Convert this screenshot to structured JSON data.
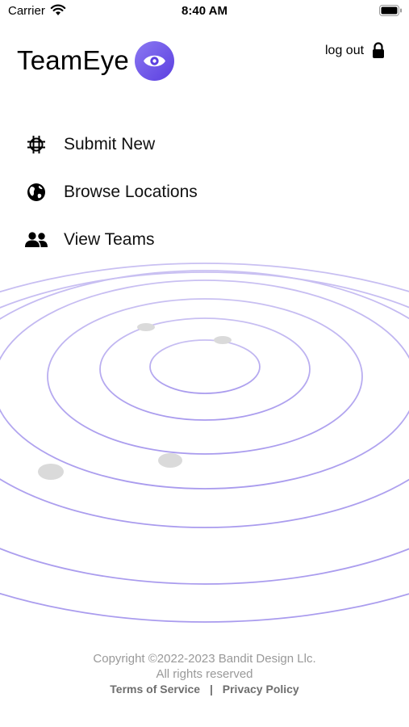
{
  "status_bar": {
    "carrier": "Carrier",
    "time": "8:40 AM",
    "wifi_icon": "wifi-icon",
    "battery_icon": "battery-icon"
  },
  "header": {
    "brand": "TeamEye",
    "logo_icon": "eye-icon",
    "accent_color": "#6b4fe8",
    "logout_label": "log out",
    "logout_icon": "lock-icon"
  },
  "menu": {
    "items": [
      {
        "label": "Submit New",
        "icon": "crosshair-icon"
      },
      {
        "label": "Browse Locations",
        "icon": "globe-icon"
      },
      {
        "label": "View Teams",
        "icon": "people-icon"
      }
    ]
  },
  "footer": {
    "copyright": "Copyright ©2022-2023 Bandit Design Llc.",
    "rights": "All rights reserved",
    "terms_label": "Terms of Service",
    "separator": "|",
    "privacy_label": "Privacy Policy"
  }
}
